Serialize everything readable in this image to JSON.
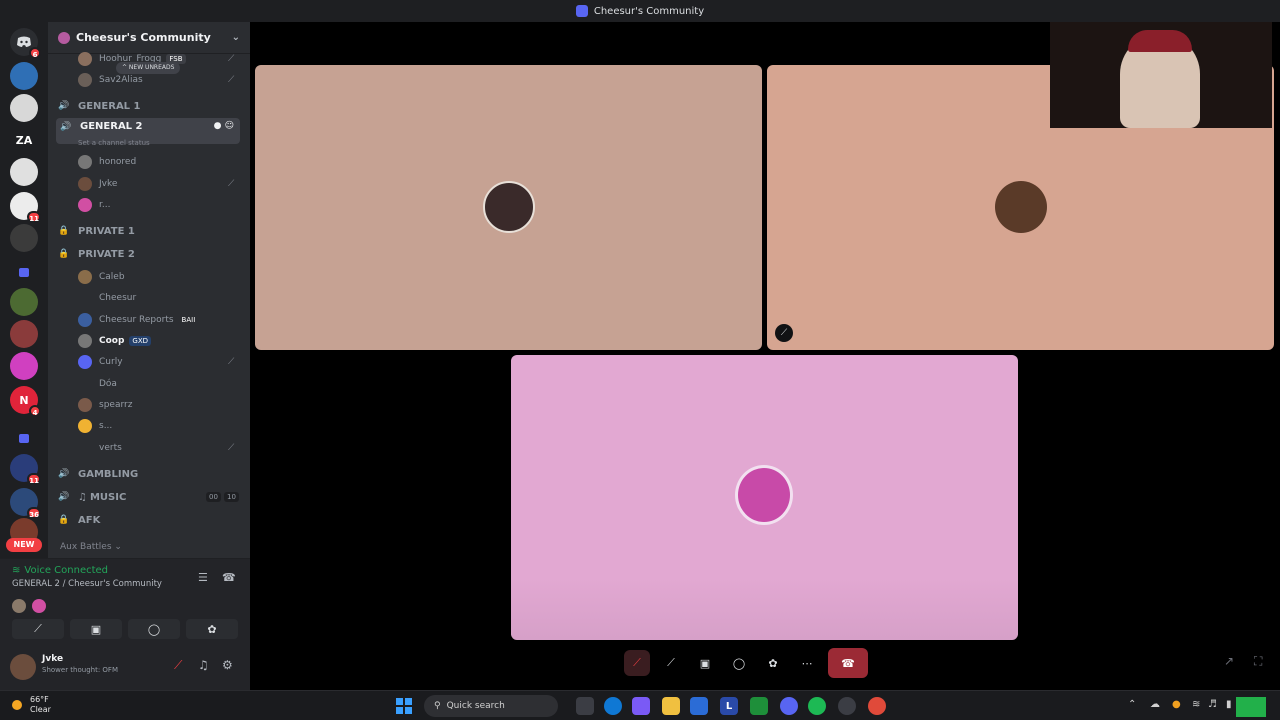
{
  "window": {
    "title": "Cheesur's Community"
  },
  "server": {
    "name": "Cheesur's Community",
    "new_unreads": "^ NEW UNREADS"
  },
  "rail": {
    "badges": [
      "6",
      "11",
      "11",
      "4",
      "11",
      "36"
    ],
    "text_server": "ZA",
    "n_server": "N",
    "new_pill": "NEW"
  },
  "members_top": [
    {
      "name": "Hoohur_Frogg",
      "tag": "FSB"
    },
    {
      "name": "Sav2Alias"
    }
  ],
  "channels": {
    "general1": "GENERAL 1",
    "general2": "GENERAL 2",
    "general2_status": "Set a channel status",
    "private1": "PRIVATE 1",
    "private2": "PRIVATE 2",
    "gambling": "GAMBLING",
    "music": "MUSIC",
    "music_count_a": "00",
    "music_count_b": "10",
    "afk": "AFK",
    "aux": "Aux Battles"
  },
  "members_general2": [
    "honored",
    "Jvke",
    "r..."
  ],
  "members_private2": [
    {
      "name": "Caleb"
    },
    {
      "name": "Cheesur"
    },
    {
      "name": "Cheesur Reports",
      "tag": "BAII"
    },
    {
      "name": "Coop",
      "tag": "GXD"
    },
    {
      "name": "Curly"
    },
    {
      "name": "Dóa"
    },
    {
      "name": "spearrz"
    },
    {
      "name": "s..."
    },
    {
      "name": "verts"
    }
  ],
  "voice": {
    "connected": "Voice Connected",
    "channel": "GENERAL 2 / Cheesur's Community"
  },
  "user": {
    "name": "Jvke",
    "status": "Shower thought: OFM"
  },
  "taskbar": {
    "temperature": "66°F",
    "condition": "Clear",
    "search_placeholder": "Quick search",
    "app_letter": "L"
  },
  "colors": {
    "tile_left": "#c6a293",
    "tile_right": "#d6a591",
    "tile_bottom": "#e2a8d2",
    "end_call": "#9b2a35",
    "voice_green": "#23a55a"
  }
}
